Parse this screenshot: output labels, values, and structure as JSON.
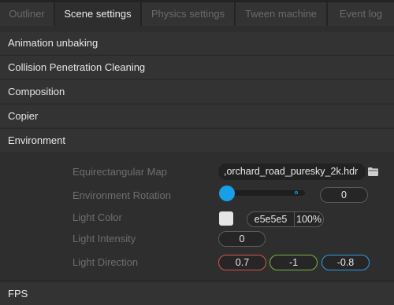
{
  "tabs": [
    {
      "label": "Outliner"
    },
    {
      "label": "Scene settings"
    },
    {
      "label": "Physics settings"
    },
    {
      "label": "Tween machine"
    },
    {
      "label": "Event log"
    }
  ],
  "sections": [
    {
      "label": "Animation unbaking"
    },
    {
      "label": "Collision Penetration Cleaning"
    },
    {
      "label": "Composition"
    },
    {
      "label": "Copier"
    },
    {
      "label": "Environment"
    },
    {
      "label": "FPS"
    }
  ],
  "environment": {
    "equirect_label": "Equirectangular Map",
    "equirect_value": ",orchard_road_puresky_2k.hdr",
    "folder_icon": "folder-icon",
    "rotation_label": "Environment Rotation",
    "rotation_value": "0",
    "rotation_slider_fraction": 0,
    "light_color_label": "Light Color",
    "light_color_hex": "e5e5e5",
    "light_color_alpha": "100%",
    "light_color_swatch": "#e5e5e5",
    "light_intensity_label": "Light Intensity",
    "light_intensity_value": "0",
    "light_direction_label": "Light Direction",
    "light_direction_x": "0.7",
    "light_direction_y": "-1",
    "light_direction_z": "-0.8"
  },
  "colors": {
    "accent": "#17a0e8",
    "axis_x": "#d9534f",
    "axis_y": "#7cb342",
    "axis_z": "#2e9be6"
  }
}
